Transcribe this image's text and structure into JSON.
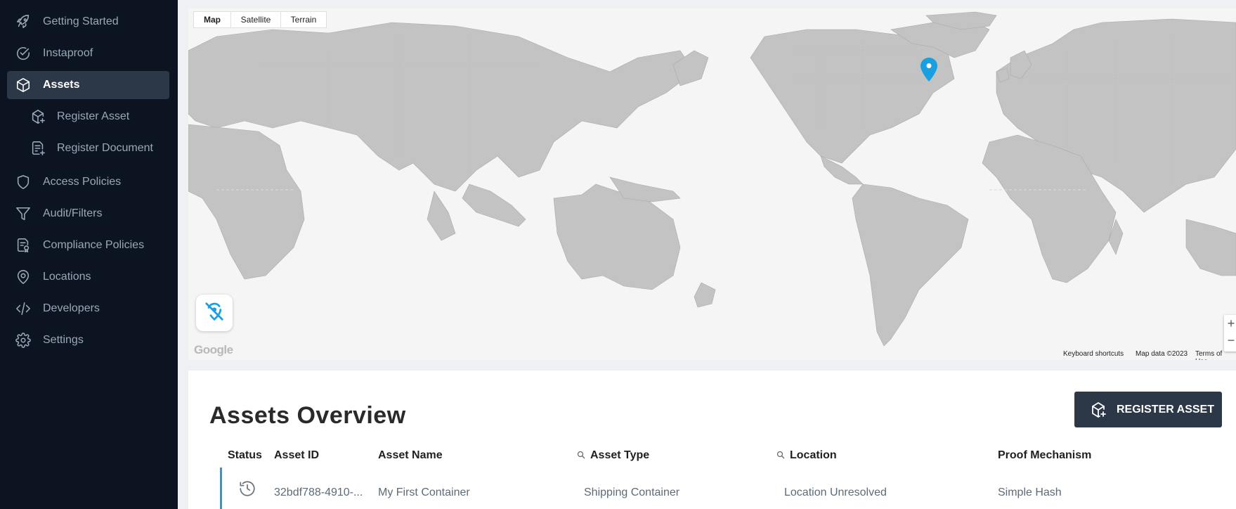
{
  "sidebar": {
    "items": [
      {
        "label": "Getting Started",
        "icon": "rocket-icon"
      },
      {
        "label": "Instaproof",
        "icon": "check-circle-icon"
      },
      {
        "label": "Assets",
        "icon": "cube-icon",
        "active": true
      },
      {
        "label": "Register Asset",
        "icon": "cube-add-icon",
        "sub": true
      },
      {
        "label": "Register Document",
        "icon": "document-add-icon",
        "sub": true
      },
      {
        "label": "Access Policies",
        "icon": "shield-icon"
      },
      {
        "label": "Audit/Filters",
        "icon": "filter-icon"
      },
      {
        "label": "Compliance Policies",
        "icon": "compliance-document-icon"
      },
      {
        "label": "Locations",
        "icon": "location-pin-icon"
      },
      {
        "label": "Developers",
        "icon": "code-icon"
      },
      {
        "label": "Settings",
        "icon": "gear-icon"
      }
    ]
  },
  "map": {
    "types": [
      "Map",
      "Satellite",
      "Terrain"
    ],
    "selected_type": "Map",
    "google_logo": "Google",
    "keyboard_shortcuts": "Keyboard shortcuts",
    "map_data": "Map data ©2023",
    "terms": "Terms of Use",
    "zoom_in": "+",
    "zoom_out": "−",
    "pin_color": "#1aa0e0"
  },
  "overview": {
    "title": "Assets Overview",
    "register_button": "REGISTER ASSET",
    "columns": [
      "Status",
      "Asset ID",
      "Asset Name",
      "Asset Type",
      "Location",
      "Proof Mechanism"
    ],
    "rows": [
      {
        "status_icon": "history-clock-icon",
        "asset_id": "32bdf788-4910-...",
        "asset_name": "My First Container",
        "asset_type": "Shipping Container",
        "location": "Location Unresolved",
        "proof_mechanism": "Simple Hash"
      }
    ]
  },
  "colors": {
    "sidebar_bg": "#0b1420",
    "active_item_bg": "#2c3748",
    "accent": "#1aa0e0",
    "button_bg": "#2c3748"
  }
}
